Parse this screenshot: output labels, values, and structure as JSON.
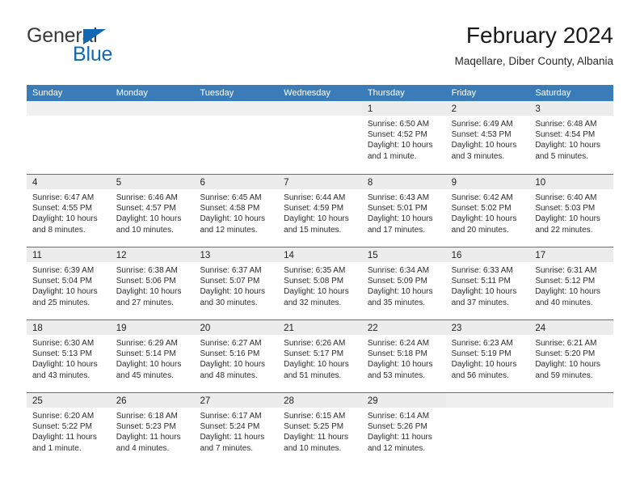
{
  "brand": {
    "name_part1": "General",
    "name_part2": "Blue",
    "triangle_icon": "triangle-icon",
    "accent_color": "#1268b3"
  },
  "header": {
    "title": "February 2024",
    "subtitle": "Maqellare, Diber County, Albania"
  },
  "calendar": {
    "header_bg": "#3a7cb8",
    "day_band_bg": "#ececec",
    "weekdays": [
      "Sunday",
      "Monday",
      "Tuesday",
      "Wednesday",
      "Thursday",
      "Friday",
      "Saturday"
    ],
    "weeks": [
      [
        {
          "day": "",
          "sunrise": "",
          "sunset": "",
          "daylight1": "",
          "daylight2": ""
        },
        {
          "day": "",
          "sunrise": "",
          "sunset": "",
          "daylight1": "",
          "daylight2": ""
        },
        {
          "day": "",
          "sunrise": "",
          "sunset": "",
          "daylight1": "",
          "daylight2": ""
        },
        {
          "day": "",
          "sunrise": "",
          "sunset": "",
          "daylight1": "",
          "daylight2": ""
        },
        {
          "day": "1",
          "sunrise": "Sunrise: 6:50 AM",
          "sunset": "Sunset: 4:52 PM",
          "daylight1": "Daylight: 10 hours",
          "daylight2": "and 1 minute."
        },
        {
          "day": "2",
          "sunrise": "Sunrise: 6:49 AM",
          "sunset": "Sunset: 4:53 PM",
          "daylight1": "Daylight: 10 hours",
          "daylight2": "and 3 minutes."
        },
        {
          "day": "3",
          "sunrise": "Sunrise: 6:48 AM",
          "sunset": "Sunset: 4:54 PM",
          "daylight1": "Daylight: 10 hours",
          "daylight2": "and 5 minutes."
        }
      ],
      [
        {
          "day": "4",
          "sunrise": "Sunrise: 6:47 AM",
          "sunset": "Sunset: 4:55 PM",
          "daylight1": "Daylight: 10 hours",
          "daylight2": "and 8 minutes."
        },
        {
          "day": "5",
          "sunrise": "Sunrise: 6:46 AM",
          "sunset": "Sunset: 4:57 PM",
          "daylight1": "Daylight: 10 hours",
          "daylight2": "and 10 minutes."
        },
        {
          "day": "6",
          "sunrise": "Sunrise: 6:45 AM",
          "sunset": "Sunset: 4:58 PM",
          "daylight1": "Daylight: 10 hours",
          "daylight2": "and 12 minutes."
        },
        {
          "day": "7",
          "sunrise": "Sunrise: 6:44 AM",
          "sunset": "Sunset: 4:59 PM",
          "daylight1": "Daylight: 10 hours",
          "daylight2": "and 15 minutes."
        },
        {
          "day": "8",
          "sunrise": "Sunrise: 6:43 AM",
          "sunset": "Sunset: 5:01 PM",
          "daylight1": "Daylight: 10 hours",
          "daylight2": "and 17 minutes."
        },
        {
          "day": "9",
          "sunrise": "Sunrise: 6:42 AM",
          "sunset": "Sunset: 5:02 PM",
          "daylight1": "Daylight: 10 hours",
          "daylight2": "and 20 minutes."
        },
        {
          "day": "10",
          "sunrise": "Sunrise: 6:40 AM",
          "sunset": "Sunset: 5:03 PM",
          "daylight1": "Daylight: 10 hours",
          "daylight2": "and 22 minutes."
        }
      ],
      [
        {
          "day": "11",
          "sunrise": "Sunrise: 6:39 AM",
          "sunset": "Sunset: 5:04 PM",
          "daylight1": "Daylight: 10 hours",
          "daylight2": "and 25 minutes."
        },
        {
          "day": "12",
          "sunrise": "Sunrise: 6:38 AM",
          "sunset": "Sunset: 5:06 PM",
          "daylight1": "Daylight: 10 hours",
          "daylight2": "and 27 minutes."
        },
        {
          "day": "13",
          "sunrise": "Sunrise: 6:37 AM",
          "sunset": "Sunset: 5:07 PM",
          "daylight1": "Daylight: 10 hours",
          "daylight2": "and 30 minutes."
        },
        {
          "day": "14",
          "sunrise": "Sunrise: 6:35 AM",
          "sunset": "Sunset: 5:08 PM",
          "daylight1": "Daylight: 10 hours",
          "daylight2": "and 32 minutes."
        },
        {
          "day": "15",
          "sunrise": "Sunrise: 6:34 AM",
          "sunset": "Sunset: 5:09 PM",
          "daylight1": "Daylight: 10 hours",
          "daylight2": "and 35 minutes."
        },
        {
          "day": "16",
          "sunrise": "Sunrise: 6:33 AM",
          "sunset": "Sunset: 5:11 PM",
          "daylight1": "Daylight: 10 hours",
          "daylight2": "and 37 minutes."
        },
        {
          "day": "17",
          "sunrise": "Sunrise: 6:31 AM",
          "sunset": "Sunset: 5:12 PM",
          "daylight1": "Daylight: 10 hours",
          "daylight2": "and 40 minutes."
        }
      ],
      [
        {
          "day": "18",
          "sunrise": "Sunrise: 6:30 AM",
          "sunset": "Sunset: 5:13 PM",
          "daylight1": "Daylight: 10 hours",
          "daylight2": "and 43 minutes."
        },
        {
          "day": "19",
          "sunrise": "Sunrise: 6:29 AM",
          "sunset": "Sunset: 5:14 PM",
          "daylight1": "Daylight: 10 hours",
          "daylight2": "and 45 minutes."
        },
        {
          "day": "20",
          "sunrise": "Sunrise: 6:27 AM",
          "sunset": "Sunset: 5:16 PM",
          "daylight1": "Daylight: 10 hours",
          "daylight2": "and 48 minutes."
        },
        {
          "day": "21",
          "sunrise": "Sunrise: 6:26 AM",
          "sunset": "Sunset: 5:17 PM",
          "daylight1": "Daylight: 10 hours",
          "daylight2": "and 51 minutes."
        },
        {
          "day": "22",
          "sunrise": "Sunrise: 6:24 AM",
          "sunset": "Sunset: 5:18 PM",
          "daylight1": "Daylight: 10 hours",
          "daylight2": "and 53 minutes."
        },
        {
          "day": "23",
          "sunrise": "Sunrise: 6:23 AM",
          "sunset": "Sunset: 5:19 PM",
          "daylight1": "Daylight: 10 hours",
          "daylight2": "and 56 minutes."
        },
        {
          "day": "24",
          "sunrise": "Sunrise: 6:21 AM",
          "sunset": "Sunset: 5:20 PM",
          "daylight1": "Daylight: 10 hours",
          "daylight2": "and 59 minutes."
        }
      ],
      [
        {
          "day": "25",
          "sunrise": "Sunrise: 6:20 AM",
          "sunset": "Sunset: 5:22 PM",
          "daylight1": "Daylight: 11 hours",
          "daylight2": "and 1 minute."
        },
        {
          "day": "26",
          "sunrise": "Sunrise: 6:18 AM",
          "sunset": "Sunset: 5:23 PM",
          "daylight1": "Daylight: 11 hours",
          "daylight2": "and 4 minutes."
        },
        {
          "day": "27",
          "sunrise": "Sunrise: 6:17 AM",
          "sunset": "Sunset: 5:24 PM",
          "daylight1": "Daylight: 11 hours",
          "daylight2": "and 7 minutes."
        },
        {
          "day": "28",
          "sunrise": "Sunrise: 6:15 AM",
          "sunset": "Sunset: 5:25 PM",
          "daylight1": "Daylight: 11 hours",
          "daylight2": "and 10 minutes."
        },
        {
          "day": "29",
          "sunrise": "Sunrise: 6:14 AM",
          "sunset": "Sunset: 5:26 PM",
          "daylight1": "Daylight: 11 hours",
          "daylight2": "and 12 minutes."
        },
        {
          "day": "",
          "sunrise": "",
          "sunset": "",
          "daylight1": "",
          "daylight2": ""
        },
        {
          "day": "",
          "sunrise": "",
          "sunset": "",
          "daylight1": "",
          "daylight2": ""
        }
      ]
    ]
  }
}
